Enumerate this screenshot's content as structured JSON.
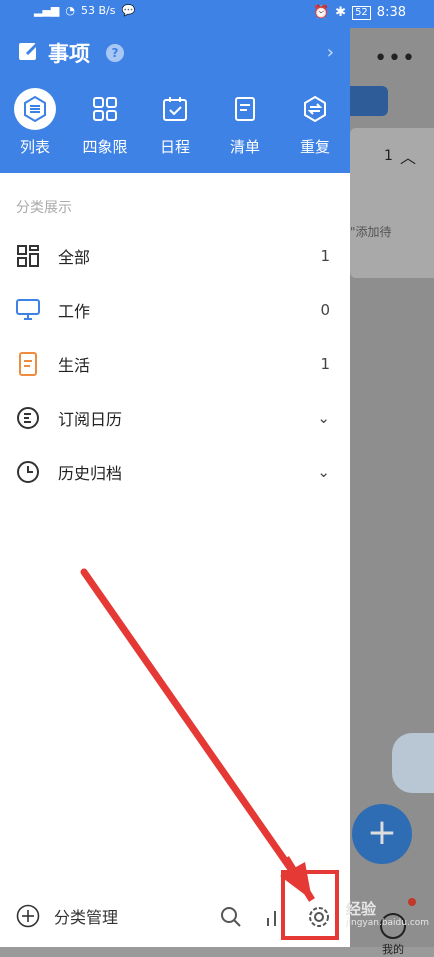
{
  "status_bar": {
    "network": "53",
    "speed_unit": "B/s",
    "battery": "52",
    "time": "8:38"
  },
  "drawer": {
    "title": "事项",
    "help_icon": "help-circle-icon",
    "tabs": [
      {
        "label": "列表",
        "icon": "list-icon",
        "active": true
      },
      {
        "label": "四象限",
        "icon": "grid-icon",
        "active": false
      },
      {
        "label": "日程",
        "icon": "calendar-icon",
        "active": false
      },
      {
        "label": "清单",
        "icon": "checklist-icon",
        "active": false
      },
      {
        "label": "重复",
        "icon": "repeat-icon",
        "active": false
      }
    ],
    "section_title": "分类展示",
    "categories": [
      {
        "label": "全部",
        "count": "1",
        "icon": "grid-icon",
        "color": "#333333"
      },
      {
        "label": "工作",
        "count": "0",
        "icon": "laptop-icon",
        "color": "#3e82e6"
      },
      {
        "label": "生活",
        "count": "1",
        "icon": "document-icon",
        "color": "#f08a3c"
      },
      {
        "label": "订阅日历",
        "count": "",
        "icon": "subscribe-icon",
        "color": "#333333"
      },
      {
        "label": "历史归档",
        "count": "",
        "icon": "clock-icon",
        "color": "#333333"
      }
    ],
    "bottom": {
      "manage_label": "分类管理",
      "icons": [
        "search-icon",
        "stats-icon",
        "settings-icon"
      ]
    }
  },
  "background_app": {
    "count": "1",
    "hint": "\"添加待",
    "tab_label": "我的"
  },
  "watermark": {
    "line1": "经验",
    "line2": "jingyan.baidu.com"
  },
  "colors": {
    "primary": "#3e82e6",
    "annotation": "#e53935"
  }
}
